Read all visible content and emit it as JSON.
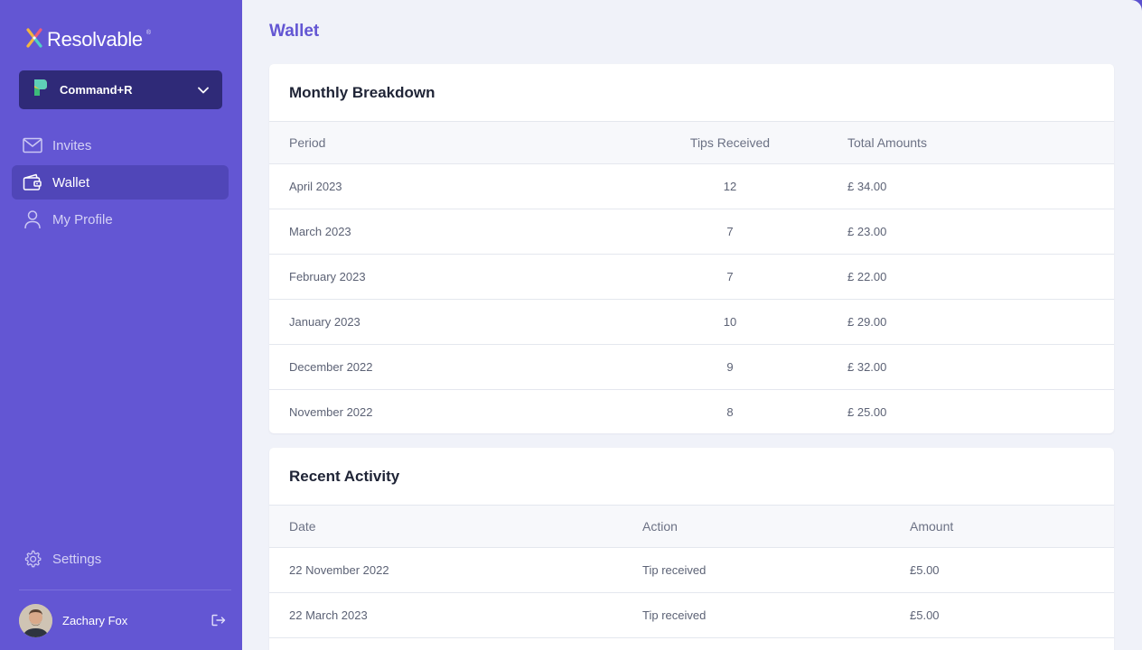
{
  "app": {
    "brand": "Resolvable",
    "brand_mark": "®"
  },
  "workspace": {
    "name": "Command+R"
  },
  "nav": {
    "items": [
      {
        "label": "Invites",
        "icon": "mail-icon",
        "active": false
      },
      {
        "label": "Wallet",
        "icon": "wallet-icon",
        "active": true
      },
      {
        "label": "My Profile",
        "icon": "user-icon",
        "active": false
      }
    ],
    "settings_label": "Settings"
  },
  "user": {
    "name": "Zachary Fox"
  },
  "page": {
    "title": "Wallet"
  },
  "monthly": {
    "title": "Monthly Breakdown",
    "columns": [
      "Period",
      "Tips Received",
      "Total Amounts"
    ],
    "rows": [
      [
        "April 2023",
        "12",
        "£ 34.00"
      ],
      [
        "March 2023",
        "7",
        "£ 23.00"
      ],
      [
        "February 2023",
        "7",
        "£ 22.00"
      ],
      [
        "January 2023",
        "10",
        "£ 29.00"
      ],
      [
        "December 2022",
        "9",
        "£ 32.00"
      ],
      [
        "November 2022",
        "8",
        "£ 25.00"
      ]
    ]
  },
  "activity": {
    "title": "Recent Activity",
    "columns": [
      "Date",
      "Action",
      "Amount"
    ],
    "rows": [
      [
        "22 November 2022",
        "Tip received",
        "£5.00"
      ],
      [
        "22 March 2023",
        "Tip received",
        "£5.00"
      ],
      [
        "",
        "",
        ""
      ]
    ]
  },
  "colors": {
    "sidebar": "#6356d3",
    "accent": "#6356d3",
    "workspace_bg": "#2f2a78",
    "background": "#f0f2f9"
  }
}
